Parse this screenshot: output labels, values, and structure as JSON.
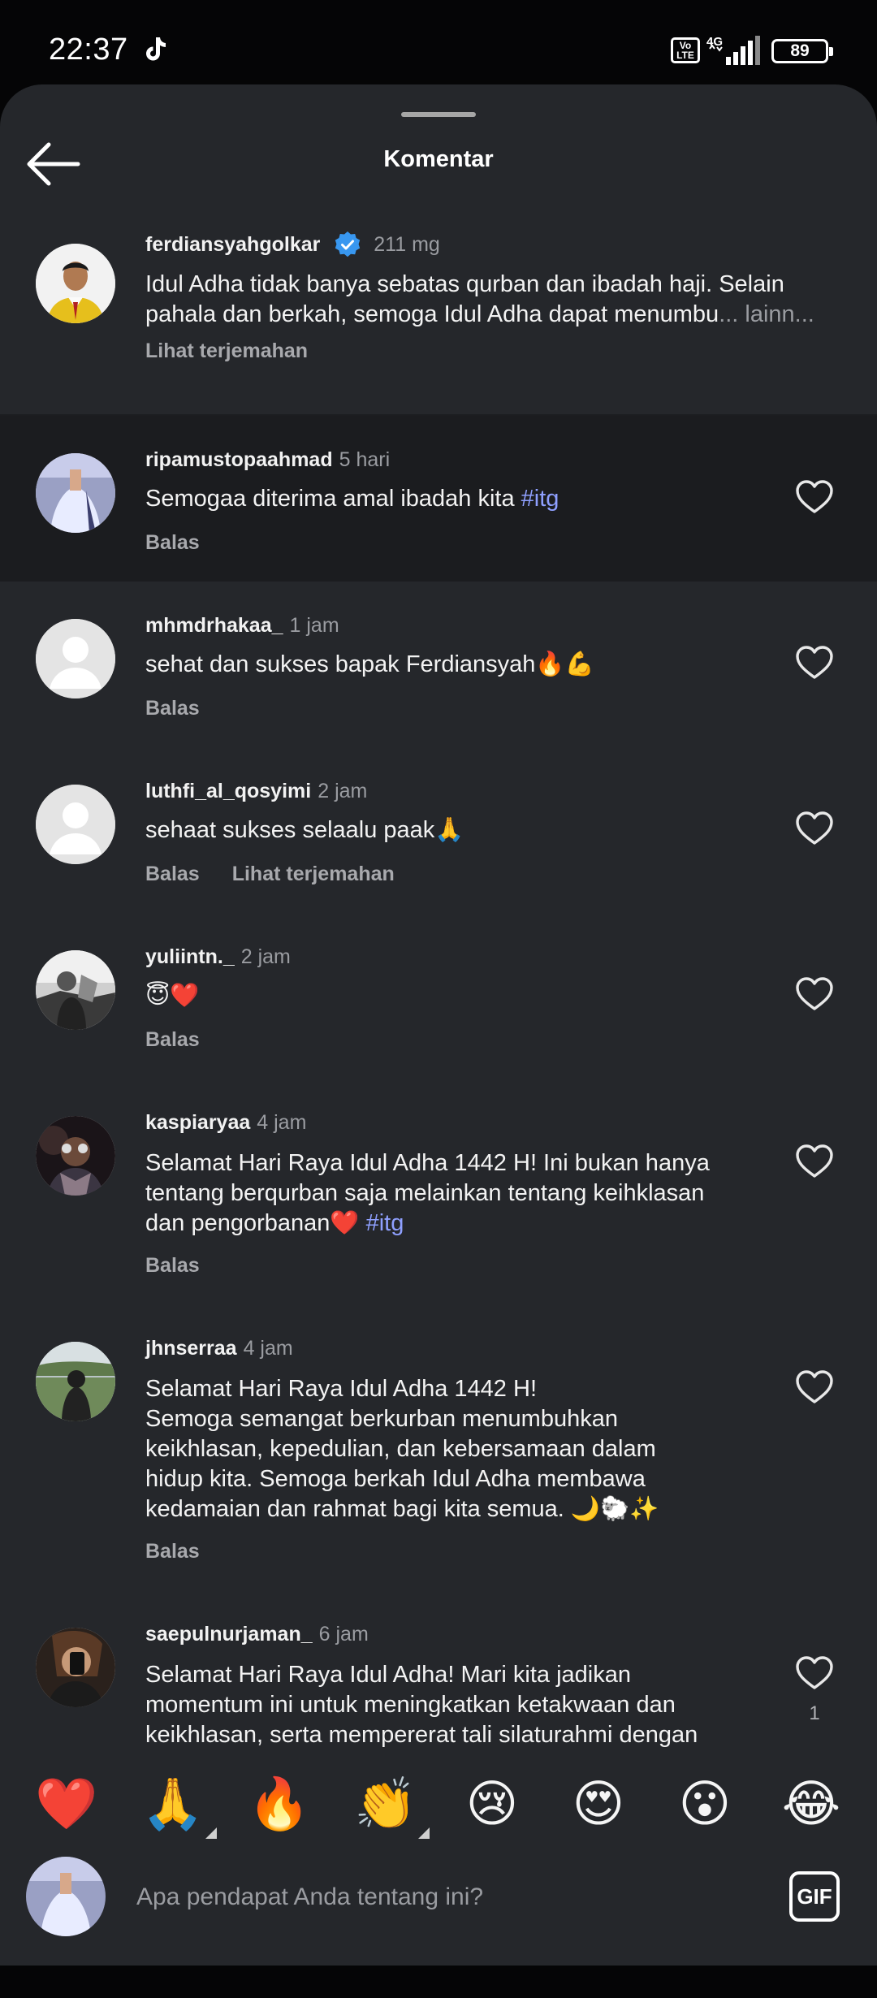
{
  "status_bar": {
    "time": "22:37",
    "network": "4G",
    "volte": "Vo LTE",
    "battery": "89"
  },
  "header": {
    "title": "Komentar",
    "back_icon": "arrow-left-icon"
  },
  "caption": {
    "username": "ferdiansyahgolkar",
    "time": "211 mg",
    "line1": "Idul Adha tidak banya sebatas qurban dan ibadah haji. Selain",
    "line2": "pahala dan berkah, semoga Idul Adha dapat menumbu",
    "more": "... lainn...",
    "translate": "Lihat terjemahan"
  },
  "comments": [
    {
      "username": "ripamustopaahmad",
      "time": "5 hari",
      "lines": [
        "Semogaa diterima amal ibadah kita "
      ],
      "tag": "#itg",
      "reply": "Balas",
      "translate": ""
    },
    {
      "username": "mhmdrhakaa_",
      "time": "1 jam",
      "lines": [
        "sehat dan sukses bapak Ferdiansyah🔥💪"
      ],
      "reply": "Balas",
      "translate": ""
    },
    {
      "username": "luthfi_al_qosyimi",
      "time": "2 jam",
      "lines": [
        "sehaat sukses selaalu paak🙏"
      ],
      "reply": "Balas",
      "translate": "Lihat terjemahan"
    },
    {
      "username": "yuliintn._",
      "time": "2 jam",
      "lines": [
        "😇❤️"
      ],
      "reply": "Balas",
      "translate": ""
    },
    {
      "username": "kaspiaryaa",
      "time": "4 jam",
      "lines": [
        "Selamat Hari Raya Idul Adha 1442 H! Ini bukan hanya",
        "tentang berqurban saja melainkan tentang keihklasan",
        "dan pengorbanan❤️ "
      ],
      "tag": "#itg",
      "reply": "Balas",
      "translate": ""
    },
    {
      "username": "jhnserraa",
      "time": "4 jam",
      "lines": [
        "Selamat Hari Raya Idul Adha 1442 H!",
        "Semoga semangat berkurban menumbuhkan",
        "keikhlasan, kepedulian, dan kebersamaan dalam",
        "hidup kita. Semoga berkah Idul Adha membawa",
        "kedamaian dan rahmat bagi kita semua. 🌙🐑✨"
      ],
      "reply": "Balas",
      "translate": ""
    },
    {
      "username": "saepulnurjaman_",
      "time": "6 jam",
      "lines": [
        "Selamat Hari Raya Idul Adha! Mari kita jadikan",
        "momentum ini untuk meningkatkan ketakwaan dan",
        "keikhlasan, serta mempererat tali silaturahmi dengan"
      ],
      "reply": "",
      "translate": "",
      "likes": "1"
    }
  ],
  "reactions": [
    "❤️",
    "🙏",
    "🔥",
    "👏",
    "😢",
    "😍",
    "😮",
    "😂"
  ],
  "input": {
    "placeholder": "Apa pendapat Anda tentang ini?",
    "gif_label": "GIF"
  },
  "colors": {
    "sheet_bg": "#25272b",
    "highlight_bg": "#1b1c1f",
    "hashtag": "#8fa0ff",
    "verified": "#3897f0"
  }
}
